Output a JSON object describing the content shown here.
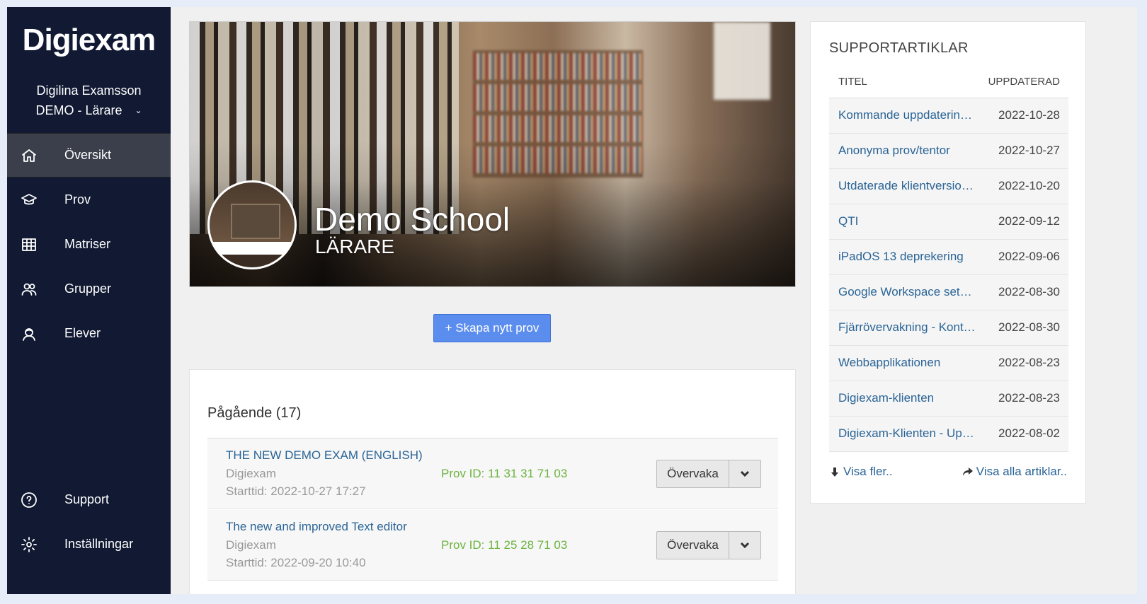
{
  "sidebar": {
    "logo": "Digiexam",
    "user_name": "Digilina Examsson",
    "user_role": "DEMO - Lärare",
    "nav": [
      {
        "label": "Översikt",
        "icon": "home-icon",
        "active": true
      },
      {
        "label": "Prov",
        "icon": "graduation-cap-icon",
        "active": false
      },
      {
        "label": "Matriser",
        "icon": "grid-table-icon",
        "active": false
      },
      {
        "label": "Grupper",
        "icon": "users-group-icon",
        "active": false
      },
      {
        "label": "Elever",
        "icon": "student-icon",
        "active": false
      }
    ],
    "bottom_nav": [
      {
        "label": "Support",
        "icon": "help-circle-icon"
      },
      {
        "label": "Inställningar",
        "icon": "gear-icon"
      }
    ]
  },
  "hero": {
    "school_name": "Demo School",
    "role": "LÄRARE"
  },
  "create_button": "+ Skapa nytt prov",
  "ongoing": {
    "title": "Pågående (17)",
    "exams": [
      {
        "title": "THE NEW DEMO EXAM (ENGLISH)",
        "org": "Digiexam",
        "start": "Starttid: 2022-10-27 17:27",
        "prov_id": "Prov ID: 11 31 31 71 03",
        "action": "Övervaka"
      },
      {
        "title": "The new and improved Text editor",
        "org": "Digiexam",
        "start": "Starttid: 2022-09-20 10:40",
        "prov_id": "Prov ID: 11 25 28 71 03",
        "action": "Övervaka"
      }
    ]
  },
  "support": {
    "title": "SUPPORTARTIKLAR",
    "col_title": "TITEL",
    "col_updated": "UPPDATERAD",
    "articles": [
      {
        "title": "Kommande uppdaterin…",
        "date": "2022-10-28"
      },
      {
        "title": "Anonyma prov/tentor",
        "date": "2022-10-27"
      },
      {
        "title": "Utdaterade klientversio…",
        "date": "2022-10-20"
      },
      {
        "title": "QTI",
        "date": "2022-09-12"
      },
      {
        "title": "iPadOS 13 deprekering",
        "date": "2022-09-06"
      },
      {
        "title": "Google Workspace set…",
        "date": "2022-08-30"
      },
      {
        "title": "Fjärrövervakning - Kont…",
        "date": "2022-08-30"
      },
      {
        "title": "Webbapplikationen",
        "date": "2022-08-23"
      },
      {
        "title": "Digiexam-klienten",
        "date": "2022-08-23"
      },
      {
        "title": "Digiexam-Klienten - Up…",
        "date": "2022-08-02"
      }
    ],
    "more_link": "Visa fler..",
    "all_link": "Visa alla artiklar.."
  },
  "colors": {
    "sidebar_bg": "#111933",
    "accent_button": "#5b8def",
    "link": "#2a6496",
    "id_green": "#6cb33f"
  }
}
